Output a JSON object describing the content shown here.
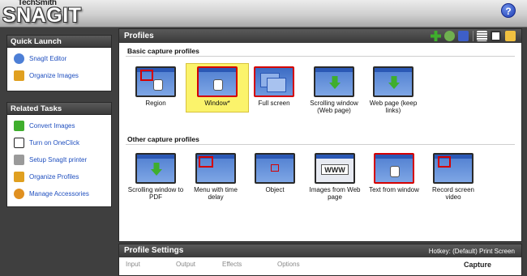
{
  "app": {
    "brand_small": "TechSmith",
    "brand_big": "SNAGIT",
    "help_label": "?"
  },
  "quick_launch": {
    "title": "Quick Launch",
    "items": [
      {
        "label": "SnagIt Editor",
        "icon": "snagit-editor-icon",
        "color": "#4d7fd6"
      },
      {
        "label": "Organize Images",
        "icon": "organize-images-icon",
        "color": "#e0a020"
      }
    ]
  },
  "related_tasks": {
    "title": "Related Tasks",
    "items": [
      {
        "label": "Convert Images",
        "icon": "convert-images-icon",
        "color": "#3fae2d"
      },
      {
        "label": "Turn on OneClick",
        "icon": "oneclick-icon",
        "color": "#222222"
      },
      {
        "label": "Setup SnagIt printer",
        "icon": "printer-icon",
        "color": "#999999"
      },
      {
        "label": "Organize Profiles",
        "icon": "organize-profiles-icon",
        "color": "#e0a020"
      },
      {
        "label": "Manage Accessories",
        "icon": "accessories-icon",
        "color": "#e09020"
      }
    ]
  },
  "profiles": {
    "title": "Profiles",
    "basic_title": "Basic capture profiles",
    "basic": [
      {
        "label": "Region"
      },
      {
        "label": "Window*"
      },
      {
        "label": "Full screen"
      },
      {
        "label": "Scrolling window (Web page)"
      },
      {
        "label": "Web page (keep links)"
      }
    ],
    "other_title": "Other capture profiles",
    "other": [
      {
        "label": "Scrolling window to PDF"
      },
      {
        "label": "Menu with time delay"
      },
      {
        "label": "Object"
      },
      {
        "label": "Images from Web page"
      },
      {
        "label": "Text from window"
      },
      {
        "label": "Record screen video"
      }
    ],
    "www_text": "WWW"
  },
  "settings": {
    "title": "Profile Settings",
    "hotkey": "Hotkey: (Default) Print Screen",
    "input": "Input",
    "output": "Output",
    "effects": "Effects",
    "options": "Options",
    "capture": "Capture"
  }
}
